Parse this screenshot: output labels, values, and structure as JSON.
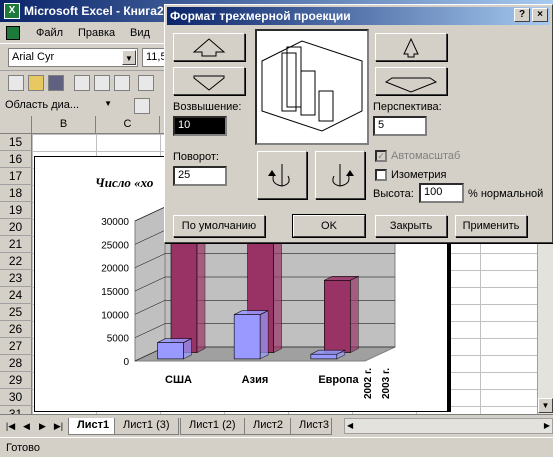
{
  "excel": {
    "title": "Microsoft Excel - Книга2",
    "menu": [
      "Файл",
      "Правка",
      "Вид"
    ],
    "font_name": "Arial Cyr",
    "font_size": "11,5",
    "name_box": "Область диа...",
    "columns": [
      "B",
      "C"
    ],
    "rows": [
      "15",
      "16",
      "17",
      "18",
      "19",
      "20",
      "21",
      "22",
      "23",
      "24",
      "25",
      "26",
      "27",
      "28",
      "29",
      "30",
      "31"
    ],
    "tabs": [
      "Лист1",
      "Лист1 (3)",
      "Лист1 (2)",
      "Лист2",
      "Лист3"
    ],
    "status": "Готово"
  },
  "chart": {
    "title_fragment": "Число «хо",
    "y_ticks": [
      "30000",
      "25000",
      "20000",
      "15000",
      "10000",
      "5000",
      "0"
    ],
    "categories": [
      "США",
      "Азия",
      "Европа"
    ],
    "depth_labels": [
      "2002 г.",
      "2003 г."
    ]
  },
  "chart_data": {
    "type": "bar",
    "categories": [
      "США",
      "Азия",
      "Европа"
    ],
    "series": [
      {
        "name": "2002 г.",
        "values": [
          3500,
          9500,
          1000
        ]
      },
      {
        "name": "2003 г.",
        "values": [
          27000,
          27000,
          15500
        ]
      }
    ],
    "ylim": [
      0,
      30000
    ],
    "colors": {
      "2002 г.": "#9999ff",
      "2003 г.": "#993366"
    },
    "projection": "3d"
  },
  "dialog": {
    "title": "Формат трехмерной проекции",
    "help": "?",
    "close": "×",
    "elevation_label": "Возвышение:",
    "elevation_value": "10",
    "rotation_label": "Поворот:",
    "rotation_value": "25",
    "perspective_label": "Перспектива:",
    "perspective_value": "5",
    "autoscale_label": "Автомасштаб",
    "isometric_label": "Изометрия",
    "height_label": "Высота:",
    "height_value": "100",
    "height_unit": "% нормальной",
    "btn_default": "По умолчанию",
    "btn_ok": "OK",
    "btn_close": "Закрыть",
    "btn_apply": "Применить"
  }
}
